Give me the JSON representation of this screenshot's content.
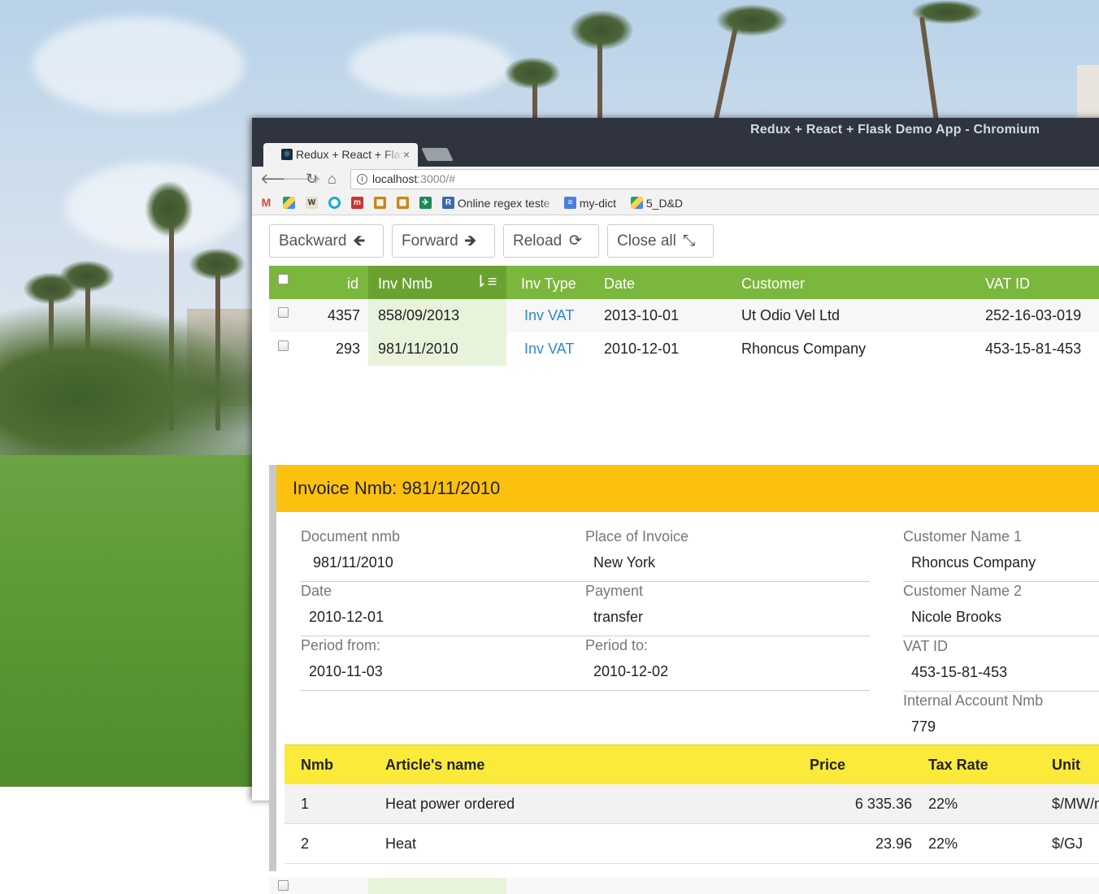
{
  "window": {
    "title": "Redux + React + Flask Demo App - Chromium"
  },
  "tab": {
    "title": "Redux + React + Flask Demo App",
    "close_glyph": "×",
    "favicon": "react-icon"
  },
  "toolbar": {
    "back_glyph": "🡐",
    "forward_glyph": "🡒",
    "reload_glyph": "↻",
    "home_glyph": "⌂",
    "url_host": "localhost",
    "url_rest": ":3000/#"
  },
  "bookmarks": {
    "items": [
      {
        "icon": "gmail-icon",
        "label": ""
      },
      {
        "icon": "drive-icon",
        "label": ""
      },
      {
        "icon": "wiki-icon",
        "label": ""
      },
      {
        "icon": "circle-icon",
        "label": ""
      },
      {
        "icon": "m-icon",
        "label": ""
      },
      {
        "icon": "fire-icon",
        "label": ""
      },
      {
        "icon": "fire2-icon",
        "label": ""
      },
      {
        "icon": "plane-icon",
        "label": ""
      },
      {
        "icon": "r-icon",
        "label": "Online regex teste"
      },
      {
        "icon": "doc-icon",
        "label": "my-dict"
      },
      {
        "icon": "drive2-icon",
        "label": "5_D&D"
      }
    ]
  },
  "navbar": {
    "backward": "Backward",
    "forward": "Forward",
    "reload": "Reload",
    "close_all": "Close all"
  },
  "grid": {
    "columns": {
      "id": "id",
      "inv_nmb": "Inv Nmb",
      "inv_type": "Inv Type",
      "date": "Date",
      "customer": "Customer",
      "vat_id": "VAT ID"
    },
    "rows": [
      {
        "id": "4357",
        "inv_nmb": "858/09/2013",
        "inv_type": "Inv VAT",
        "date": "2013-10-01",
        "customer": "Ut Odio Vel Ltd",
        "vat_id": "252-16-03-019"
      },
      {
        "id": "293",
        "inv_nmb": "981/11/2010",
        "inv_type": "Inv VAT",
        "date": "2010-12-01",
        "customer": "Rhoncus Company",
        "vat_id": "453-15-81-453"
      }
    ]
  },
  "detail": {
    "title": "Invoice Nmb: 981/11/2010",
    "fields": {
      "document_nmb": {
        "label": "Document nmb",
        "value": "981/11/2010"
      },
      "place": {
        "label": "Place of Invoice",
        "value": "New York"
      },
      "customer_name_1": {
        "label": "Customer Name 1",
        "value": "Rhoncus Company"
      },
      "date": {
        "label": "Date",
        "value": "2010-12-01"
      },
      "payment": {
        "label": "Payment",
        "value": "transfer"
      },
      "customer_name_2": {
        "label": "Customer Name 2",
        "value": "Nicole Brooks"
      },
      "period_from": {
        "label": "Period from:",
        "value": "2010-11-03"
      },
      "period_to": {
        "label": "Period to:",
        "value": "2010-12-02"
      },
      "vat_id": {
        "label": "VAT ID",
        "value": "453-15-81-453"
      },
      "internal_account": {
        "label": "Internal Account Nmb",
        "value": "779"
      }
    },
    "items": {
      "columns": {
        "nmb": "Nmb",
        "article": "Article's name",
        "price": "Price",
        "tax_rate": "Tax Rate",
        "unit": "Unit"
      },
      "rows": [
        {
          "nmb": "1",
          "article": "Heat power ordered",
          "price": "6 335.36",
          "tax_rate": "22%",
          "unit": "$/MW/m"
        },
        {
          "nmb": "2",
          "article": "Heat",
          "price": "23.96",
          "tax_rate": "22%",
          "unit": "$/GJ"
        }
      ]
    }
  },
  "colors": {
    "grid_header": "#7bb63d",
    "detail_header": "#fcc10f",
    "items_header": "#fcea3b",
    "link": "#2b8ad1"
  }
}
